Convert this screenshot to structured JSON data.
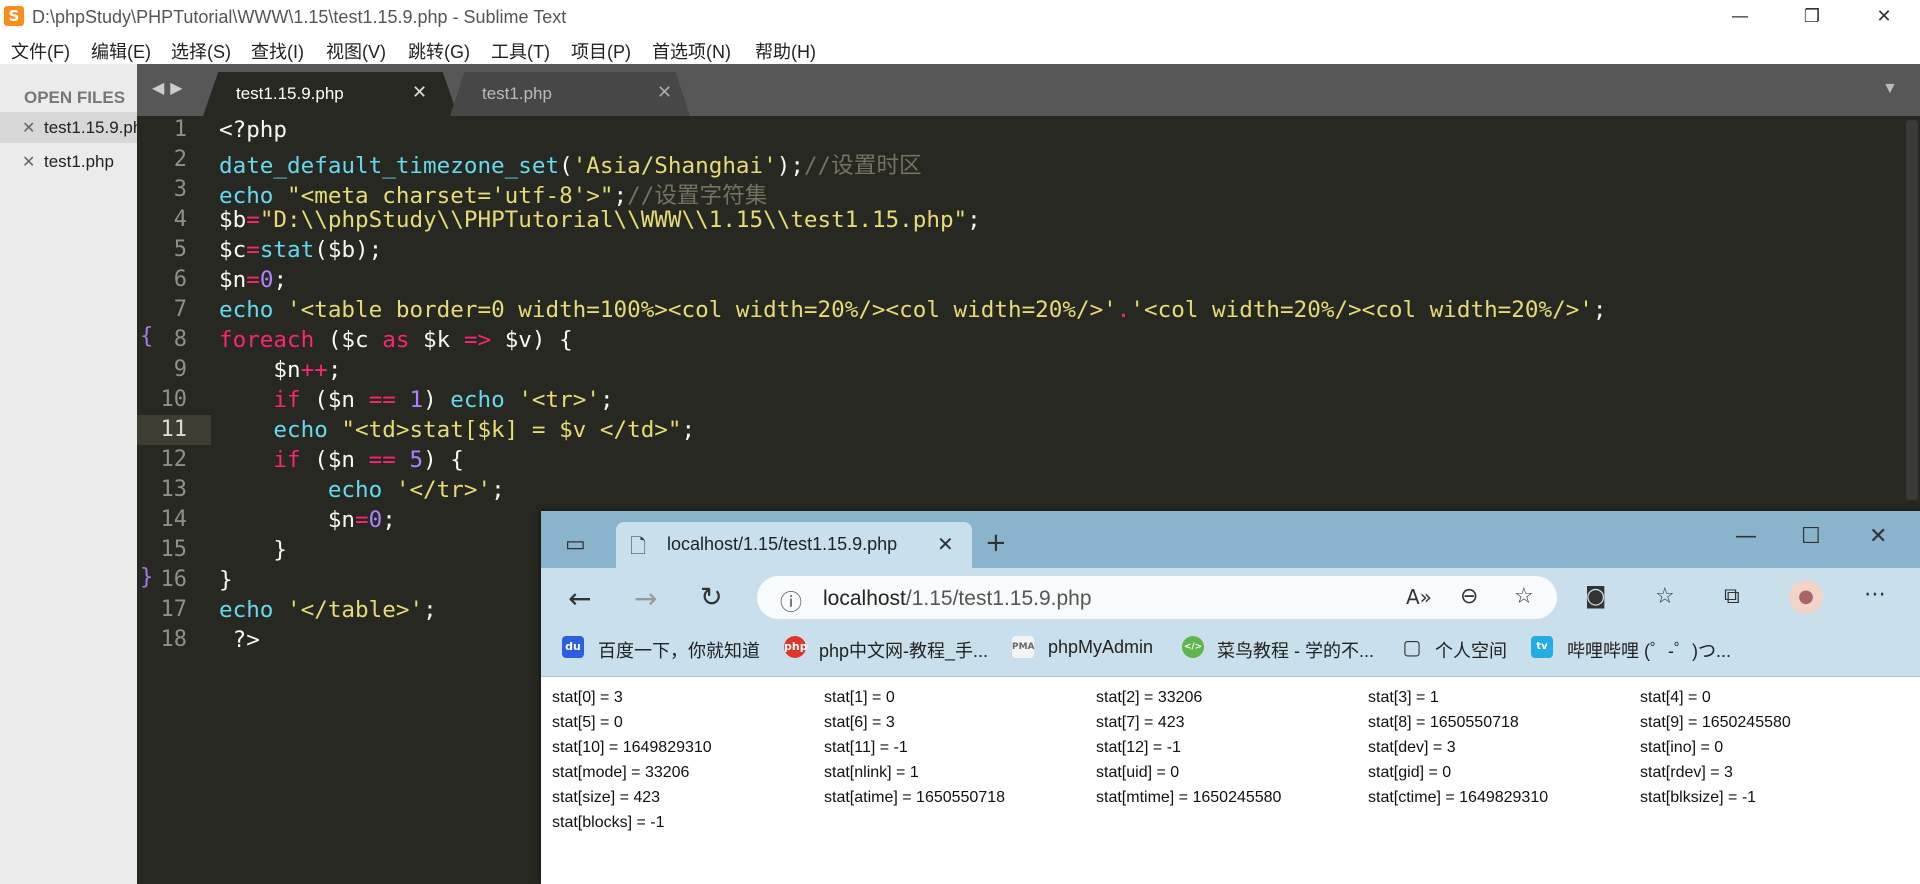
{
  "window": {
    "title": "D:\\phpStudy\\PHPTutorial\\WWW\\1.15\\test1.15.9.php - Sublime Text",
    "app_icon": "S"
  },
  "menu": [
    "文件(F)",
    "编辑(E)",
    "选择(S)",
    "查找(I)",
    "视图(V)",
    "跳转(G)",
    "工具(T)",
    "项目(P)",
    "首选项(N)",
    "帮助(H)"
  ],
  "sidebar": {
    "title": "OPEN FILES",
    "files": [
      "test1.15.9.php",
      "test1.php"
    ]
  },
  "tabs": [
    {
      "label": "test1.15.9.php",
      "active": true
    },
    {
      "label": "test1.php",
      "active": false
    }
  ],
  "line_numbers": [
    "1",
    "2",
    "3",
    "4",
    "5",
    "6",
    "7",
    "8",
    "9",
    "10",
    "11",
    "12",
    "13",
    "14",
    "15",
    "16",
    "17",
    "18"
  ],
  "code": [
    [
      [
        "",
        "<?php"
      ]
    ],
    [
      [
        "fn",
        "date_default_timezone_set"
      ],
      [
        "",
        "("
      ],
      [
        "st",
        "'Asia/Shanghai'"
      ],
      [
        "",
        ");"
      ],
      [
        "cm",
        "//设置时区"
      ]
    ],
    [
      [
        "fn",
        "echo"
      ],
      [
        "",
        ""
      ],
      [
        "st",
        " \"<meta charset='utf-8'>\""
      ],
      [
        "",
        ";"
      ],
      [
        "cm",
        "//设置字符集"
      ]
    ],
    [
      [
        "",
        "$b"
      ],
      [
        "kw",
        "="
      ],
      [
        "st",
        "\"D:\\\\phpStudy\\\\PHPTutorial\\\\WWW\\\\1.15\\\\test1.15.php\""
      ],
      [
        "",
        ";"
      ]
    ],
    [
      [
        "",
        "$c"
      ],
      [
        "kw",
        "="
      ],
      [
        "fn",
        "stat"
      ],
      [
        "",
        "($b);"
      ]
    ],
    [
      [
        "",
        "$n"
      ],
      [
        "kw",
        "="
      ],
      [
        "nm",
        "0"
      ],
      [
        "",
        ";"
      ]
    ],
    [
      [
        "fn",
        "echo"
      ],
      [
        "st",
        " '<table border=0 width=100%><col width=20%/><col width=20%/>'"
      ],
      [
        "kw",
        "."
      ],
      [
        "st",
        "'<col width=20%/><col width=20%/>'"
      ],
      [
        "",
        ";"
      ]
    ],
    [
      [
        "kw",
        "foreach"
      ],
      [
        "",
        " ($c "
      ],
      [
        "kw",
        "as"
      ],
      [
        "",
        " $k "
      ],
      [
        "kw",
        "=>"
      ],
      [
        "",
        " $v) {"
      ]
    ],
    [
      [
        "",
        "    $n"
      ],
      [
        "kw",
        "++"
      ],
      [
        "",
        ";"
      ]
    ],
    [
      [
        "kw",
        "    if"
      ],
      [
        "",
        " ($n "
      ],
      [
        "kw",
        "=="
      ],
      [
        "",
        " "
      ],
      [
        "nm",
        "1"
      ],
      [
        "",
        ") "
      ],
      [
        "fn",
        "echo"
      ],
      [
        "st",
        " '<tr>'"
      ],
      [
        "",
        ";"
      ]
    ],
    [
      [
        "fn",
        "    echo"
      ],
      [
        "st",
        " \"<td>stat[$k] = $v </td>\""
      ],
      [
        "",
        ";"
      ]
    ],
    [
      [
        "kw",
        "    if"
      ],
      [
        "",
        " ($n "
      ],
      [
        "kw",
        "=="
      ],
      [
        "",
        " "
      ],
      [
        "nm",
        "5"
      ],
      [
        "",
        ") {"
      ]
    ],
    [
      [
        "fn",
        "        echo"
      ],
      [
        "st",
        " '</tr>'"
      ],
      [
        "",
        ";"
      ]
    ],
    [
      [
        "",
        "        $n"
      ],
      [
        "kw",
        "="
      ],
      [
        "nm",
        "0"
      ],
      [
        "",
        ";"
      ]
    ],
    [
      [
        "",
        "    }"
      ]
    ],
    [
      [
        "",
        "}"
      ]
    ],
    [
      [
        "fn",
        "echo"
      ],
      [
        "st",
        " '</table>'"
      ],
      [
        "",
        ";"
      ]
    ],
    [
      [
        "",
        " ?>"
      ]
    ]
  ],
  "browser": {
    "tab_title": "localhost/1.15/test1.15.9.php",
    "url_host": "localhost",
    "url_path": "/1.15/test1.15.9.php",
    "favorites": [
      "百度一下，你就知道",
      "php中文网-教程_手...",
      "phpMyAdmin",
      "菜鸟教程 - 学的不...",
      "个人空间",
      "哔哩哔哩 (゜-゜)つ..."
    ],
    "favicons": [
      "du",
      "php",
      "PMA",
      "</>",
      "▢",
      "tv"
    ],
    "colors": {
      "titlebar": "#8ab4cc",
      "toolbar": "#c9e0ec"
    },
    "rows": [
      [
        "stat[0] = 3",
        "stat[1] = 0",
        "stat[2] = 33206",
        "stat[3] = 1",
        "stat[4] = 0"
      ],
      [
        "stat[5] = 0",
        "stat[6] = 3",
        "stat[7] = 423",
        "stat[8] = 1650550718",
        "stat[9] = 1650245580"
      ],
      [
        "stat[10] = 1649829310",
        "stat[11] = -1",
        "stat[12] = -1",
        "stat[dev] = 3",
        "stat[ino] = 0"
      ],
      [
        "stat[mode] = 33206",
        "stat[nlink] = 1",
        "stat[uid] = 0",
        "stat[gid] = 0",
        "stat[rdev] = 3"
      ],
      [
        "stat[size] = 423",
        "stat[atime] = 1650550718",
        "stat[mtime] = 1650245580",
        "stat[ctime] = 1649829310",
        "stat[blksize] = -1"
      ],
      [
        "stat[blocks] = -1"
      ]
    ]
  }
}
